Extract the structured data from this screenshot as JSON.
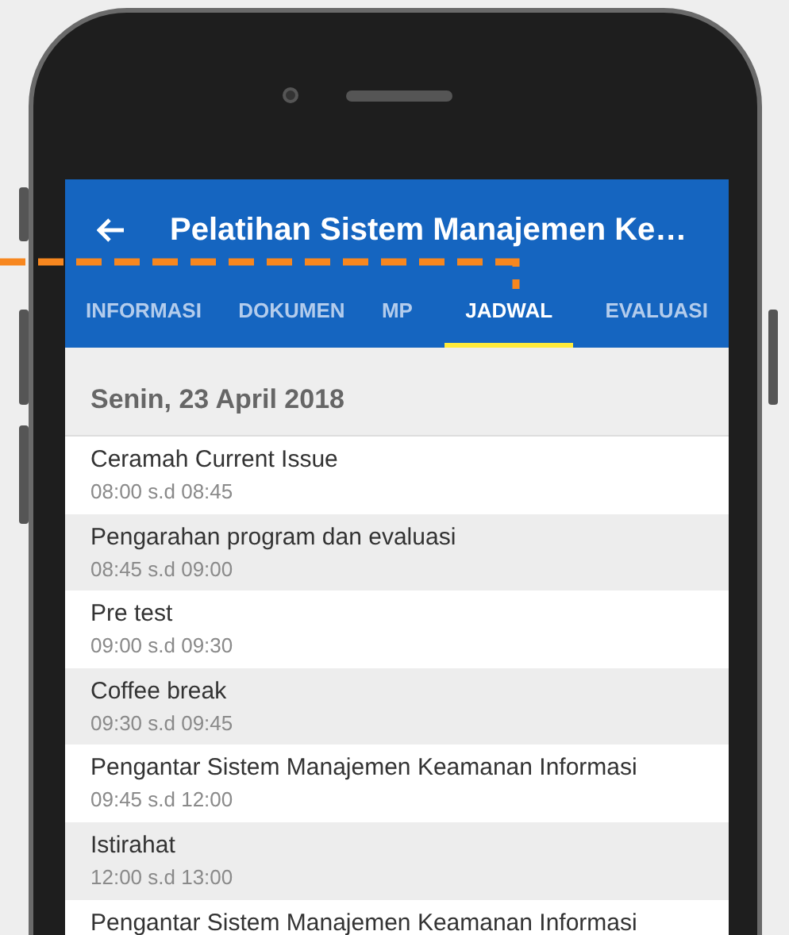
{
  "app_bar": {
    "title": "Pelatihan Sistem Manajemen Ke…"
  },
  "tabs": [
    {
      "label": "INFORMASI",
      "selected": false
    },
    {
      "label": "DOKUMEN",
      "selected": false
    },
    {
      "label": "MP",
      "selected": false
    },
    {
      "label": "JADWAL",
      "selected": true
    },
    {
      "label": "EVALUASI",
      "selected": false
    }
  ],
  "date_header": "Senin, 23 April 2018",
  "schedule": [
    {
      "title": "Ceramah Current Issue",
      "time": "08:00 s.d 08:45"
    },
    {
      "title": "Pengarahan program dan evaluasi",
      "time": "08:45 s.d 09:00"
    },
    {
      "title": "Pre test",
      "time": "09:00 s.d 09:30"
    },
    {
      "title": "Coffee break",
      "time": "09:30 s.d 09:45"
    },
    {
      "title": "Pengantar Sistem Manajemen Keamanan Informasi",
      "time": "09:45 s.d 12:00"
    },
    {
      "title": "Istirahat",
      "time": "12:00 s.d 13:00"
    },
    {
      "title": "Pengantar Sistem Manajemen Keamanan Informasi"
    }
  ]
}
